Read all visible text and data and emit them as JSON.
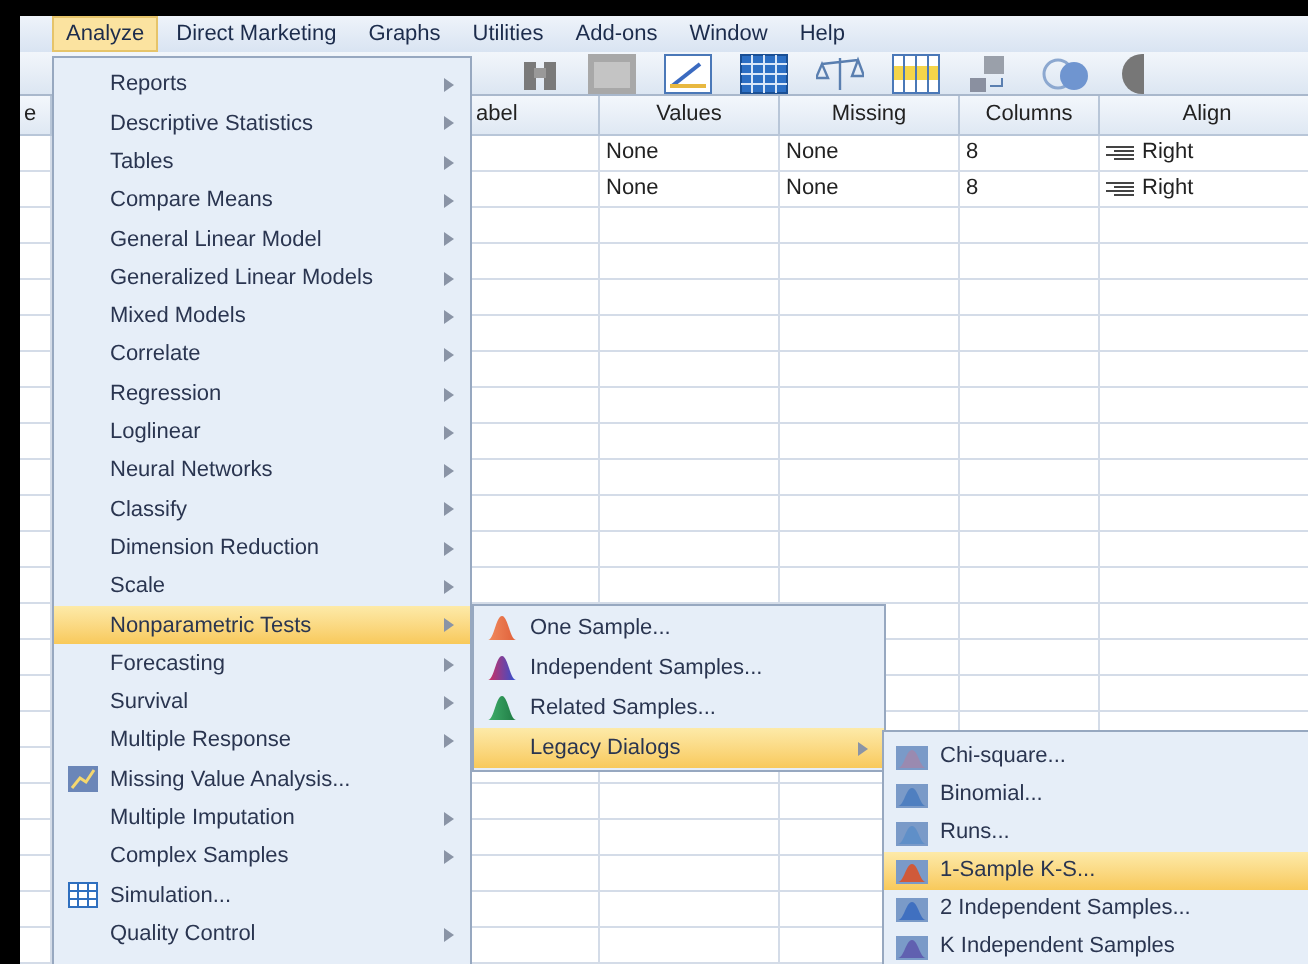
{
  "menu_bar": [
    {
      "label": "Analyze",
      "selected": true
    },
    {
      "label": "Direct Marketing",
      "selected": false
    },
    {
      "label": "Graphs",
      "selected": false
    },
    {
      "label": "Utilities",
      "selected": false
    },
    {
      "label": "Add-ons",
      "selected": false
    },
    {
      "label": "Window",
      "selected": false
    },
    {
      "label": "Help",
      "selected": false
    }
  ],
  "grid": {
    "columns": [
      "e",
      "",
      "abel",
      "Values",
      "Missing",
      "Columns",
      "Align"
    ],
    "rows": [
      [
        "",
        "",
        "",
        "None",
        "None",
        "8",
        "Right"
      ],
      [
        "",
        "",
        "",
        "None",
        "None",
        "8",
        "Right"
      ]
    ]
  },
  "analyze_menu": [
    {
      "label": "Reports",
      "kind": "submenu",
      "selected": false
    },
    {
      "label": "Descriptive Statistics",
      "kind": "submenu",
      "selected": false
    },
    {
      "label": "Tables",
      "kind": "submenu",
      "selected": false
    },
    {
      "label": "Compare Means",
      "kind": "submenu",
      "selected": false
    },
    {
      "label": "General Linear Model",
      "kind": "submenu",
      "selected": false
    },
    {
      "label": "Generalized Linear Models",
      "kind": "submenu",
      "selected": false
    },
    {
      "label": "Mixed Models",
      "kind": "submenu",
      "selected": false
    },
    {
      "label": "Correlate",
      "kind": "submenu",
      "selected": false
    },
    {
      "label": "Regression",
      "kind": "submenu",
      "selected": false
    },
    {
      "label": "Loglinear",
      "kind": "submenu",
      "selected": false
    },
    {
      "label": "Neural Networks",
      "kind": "submenu",
      "selected": false
    },
    {
      "label": "Classify",
      "kind": "submenu",
      "selected": false
    },
    {
      "label": "Dimension Reduction",
      "kind": "submenu",
      "selected": false
    },
    {
      "label": "Scale",
      "kind": "submenu",
      "selected": false
    },
    {
      "label": "Nonparametric Tests",
      "kind": "submenu",
      "selected": true
    },
    {
      "label": "Forecasting",
      "kind": "submenu",
      "selected": false
    },
    {
      "label": "Survival",
      "kind": "submenu",
      "selected": false
    },
    {
      "label": "Multiple Response",
      "kind": "submenu",
      "selected": false
    },
    {
      "label": "Missing Value Analysis...",
      "kind": "dialog",
      "selected": false
    },
    {
      "label": "Multiple Imputation",
      "kind": "submenu",
      "selected": false
    },
    {
      "label": "Complex Samples",
      "kind": "submenu",
      "selected": false
    },
    {
      "label": "Simulation...",
      "kind": "dialog",
      "selected": false
    },
    {
      "label": "Quality Control",
      "kind": "submenu",
      "selected": false
    }
  ],
  "nonparametric_menu": [
    {
      "label": "One Sample...",
      "kind": "dialog",
      "selected": false
    },
    {
      "label": "Independent Samples...",
      "kind": "dialog",
      "selected": false
    },
    {
      "label": "Related Samples...",
      "kind": "dialog",
      "selected": false
    },
    {
      "label": "Legacy Dialogs",
      "kind": "submenu",
      "selected": true
    }
  ],
  "legacy_menu": [
    {
      "label": "Chi-square...",
      "selected": false
    },
    {
      "label": "Binomial...",
      "selected": false
    },
    {
      "label": "Runs...",
      "selected": false
    },
    {
      "label": "1-Sample K-S...",
      "selected": true
    },
    {
      "label": "2 Independent Samples...",
      "selected": false
    },
    {
      "label": "K Independent Samples",
      "selected": false
    }
  ]
}
